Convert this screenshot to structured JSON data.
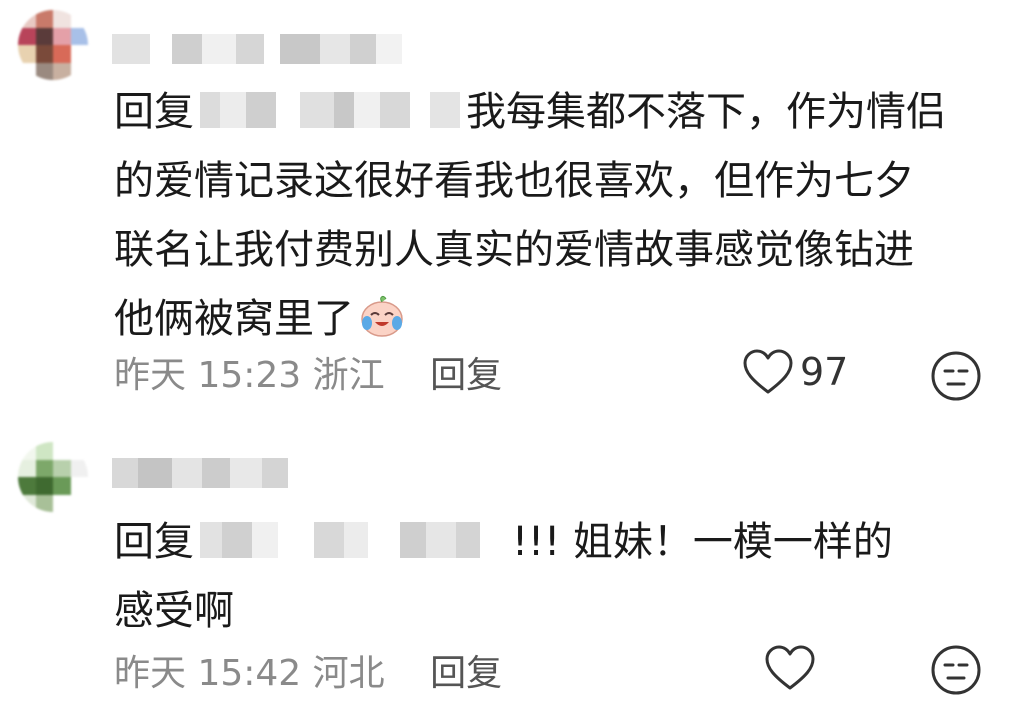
{
  "comments": [
    {
      "reply_prefix": "回复",
      "mention_hint": "铭",
      "text_lines": [
        "我每集都不落下，作为情侣",
        "的爱情记录这很好看我也很喜欢，但作为七夕",
        "联名让我付费别人真实的爱情故事感觉像钻进",
        "他俩被窝里了"
      ],
      "emoji": "crying-laughing-peach-emoji",
      "time": "昨天 15:23",
      "location": "浙江",
      "reply_label": "回复",
      "likes": "97"
    },
    {
      "reply_prefix": "回复",
      "mention_hint": "迈",
      "text_lines": [
        "!!!  姐妹！一模一样的",
        "感受啊"
      ],
      "time": "昨天 15:42",
      "location": "河北",
      "reply_label": "回复",
      "likes": ""
    }
  ],
  "icons": {
    "like": "heart-outline-icon",
    "dislike": "meh-face-icon"
  },
  "colors": {
    "text": "#1a1a1a",
    "meta": "#8a8a8a",
    "reply_btn": "#555555"
  }
}
